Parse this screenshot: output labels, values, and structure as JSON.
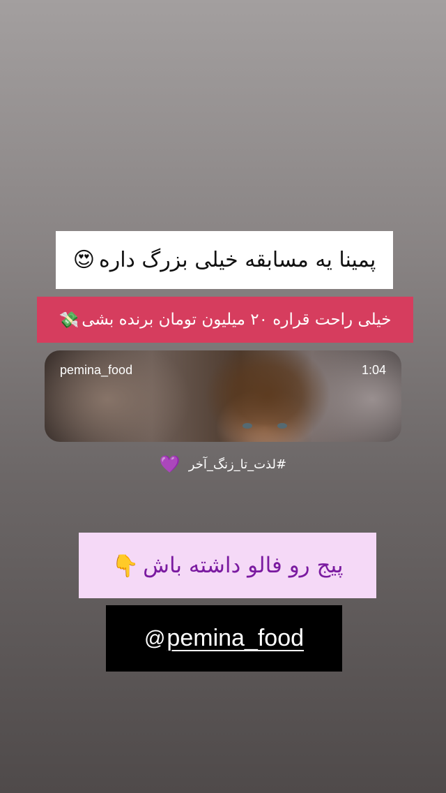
{
  "story": {
    "headline": "پمینا یه مسابقه خیلی بزرگ داره",
    "headline_emoji": "😍",
    "subline": "خیلی راحت قراره ۲۰ میلیون تومان برنده بشی",
    "subline_emoji": "💸",
    "video": {
      "username": "pemina_food",
      "duration": "1:04"
    },
    "hashtag": "#لذت_تا_زنگ_آخر",
    "hashtag_emoji": "💜",
    "follow_text": "پیج رو فالو داشته باش",
    "follow_emoji": "👇",
    "mention_icon": "@",
    "mention": "pemina_food"
  },
  "colors": {
    "subline_bg": "#d63d5e",
    "follow_bg": "#f5d9f7",
    "follow_text": "#7a1aa0",
    "mention_bg": "#000000"
  }
}
